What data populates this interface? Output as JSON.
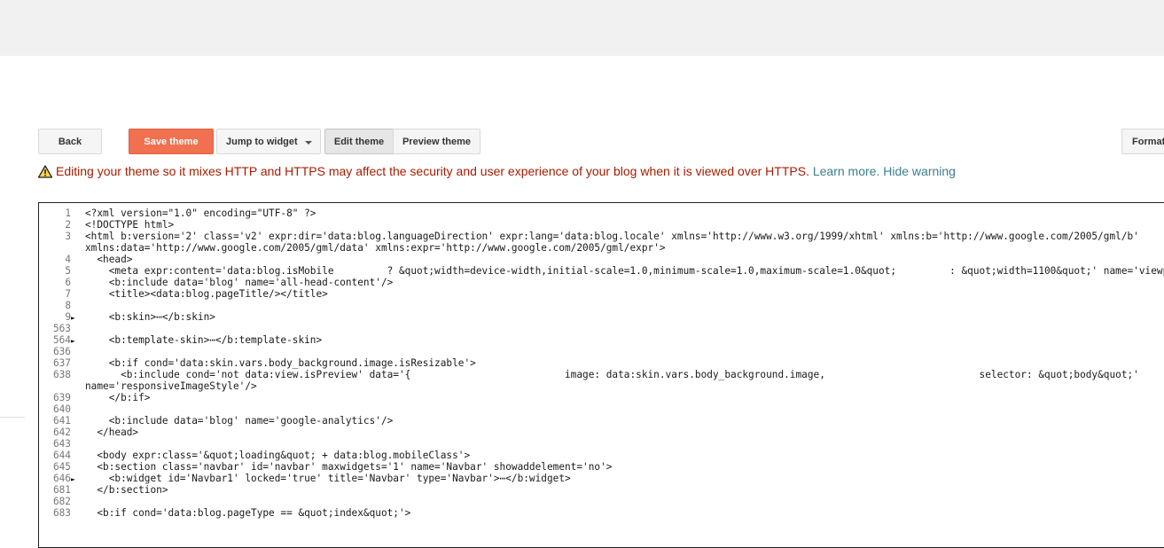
{
  "toolbar": {
    "back": "Back",
    "save": "Save theme",
    "jump": "Jump to widget",
    "edit": "Edit theme",
    "preview": "Preview theme",
    "format": "Format"
  },
  "warning": {
    "message": "Editing your theme so it mixes HTTP and HTTPS may affect the security and user experience of your blog when it is viewed over HTTPS.",
    "learn_more": "Learn more.",
    "hide": "Hide warning"
  },
  "colors": {
    "save_button": "#f0704f",
    "warning_text": "#a61c00",
    "link": "#3b7f8e"
  },
  "code_lines": [
    {
      "n": "1",
      "fold": "",
      "text": "<?xml version=\"1.0\" encoding=\"UTF-8\" ?>"
    },
    {
      "n": "2",
      "fold": "",
      "text": "<!DOCTYPE html>"
    },
    {
      "n": "3",
      "fold": "",
      "text": "<html b:version='2' class='v2' expr:dir='data:blog.languageDirection' expr:lang='data:blog.locale' xmlns='http://www.w3.org/1999/xhtml' xmlns:b='http://www.google.com/2005/gml/b'"
    },
    {
      "n": "",
      "fold": "",
      "text": "xmlns:data='http://www.google.com/2005/gml/data' xmlns:expr='http://www.google.com/2005/gml/expr'>"
    },
    {
      "n": "4",
      "fold": "",
      "text": "  <head>"
    },
    {
      "n": "5",
      "fold": "",
      "text": "    <meta expr:content='data:blog.isMobile         ? &quot;width=device-width,initial-scale=1.0,minimum-scale=1.0,maximum-scale=1.0&quot;         : &quot;width=1100&quot;' name='viewport'/>"
    },
    {
      "n": "6",
      "fold": "",
      "text": "    <b:include data='blog' name='all-head-content'/>"
    },
    {
      "n": "7",
      "fold": "",
      "text": "    <title><data:blog.pageTitle/></title>"
    },
    {
      "n": "8",
      "fold": "",
      "text": ""
    },
    {
      "n": "9",
      "fold": "►",
      "text": "    <b:skin>⋯</b:skin>"
    },
    {
      "n": "563",
      "fold": "",
      "text": ""
    },
    {
      "n": "564",
      "fold": "►",
      "text": "    <b:template-skin>⋯</b:template-skin>"
    },
    {
      "n": "636",
      "fold": "",
      "text": ""
    },
    {
      "n": "637",
      "fold": "",
      "text": "    <b:if cond='data:skin.vars.body_background.image.isResizable'>"
    },
    {
      "n": "638",
      "fold": "",
      "text": "      <b:include cond='not data:view.isPreview' data='{                          image: data:skin.vars.body_background.image,                          selector: &quot;body&quot;'"
    },
    {
      "n": "",
      "fold": "",
      "text": "name='responsiveImageStyle'/>"
    },
    {
      "n": "639",
      "fold": "",
      "text": "    </b:if>"
    },
    {
      "n": "640",
      "fold": "",
      "text": ""
    },
    {
      "n": "641",
      "fold": "",
      "text": "    <b:include data='blog' name='google-analytics'/>"
    },
    {
      "n": "642",
      "fold": "",
      "text": "  </head>"
    },
    {
      "n": "643",
      "fold": "",
      "text": ""
    },
    {
      "n": "644",
      "fold": "",
      "text": "  <body expr:class='&quot;loading&quot; + data:blog.mobileClass'>"
    },
    {
      "n": "645",
      "fold": "",
      "text": "  <b:section class='navbar' id='navbar' maxwidgets='1' name='Navbar' showaddelement='no'>"
    },
    {
      "n": "646",
      "fold": "►",
      "text": "    <b:widget id='Navbar1' locked='true' title='Navbar' type='Navbar'>⋯</b:widget>"
    },
    {
      "n": "681",
      "fold": "",
      "text": "  </b:section>"
    },
    {
      "n": "682",
      "fold": "",
      "text": ""
    },
    {
      "n": "683",
      "fold": "",
      "text": "  <b:if cond='data:blog.pageType == &quot;index&quot;'>"
    }
  ]
}
